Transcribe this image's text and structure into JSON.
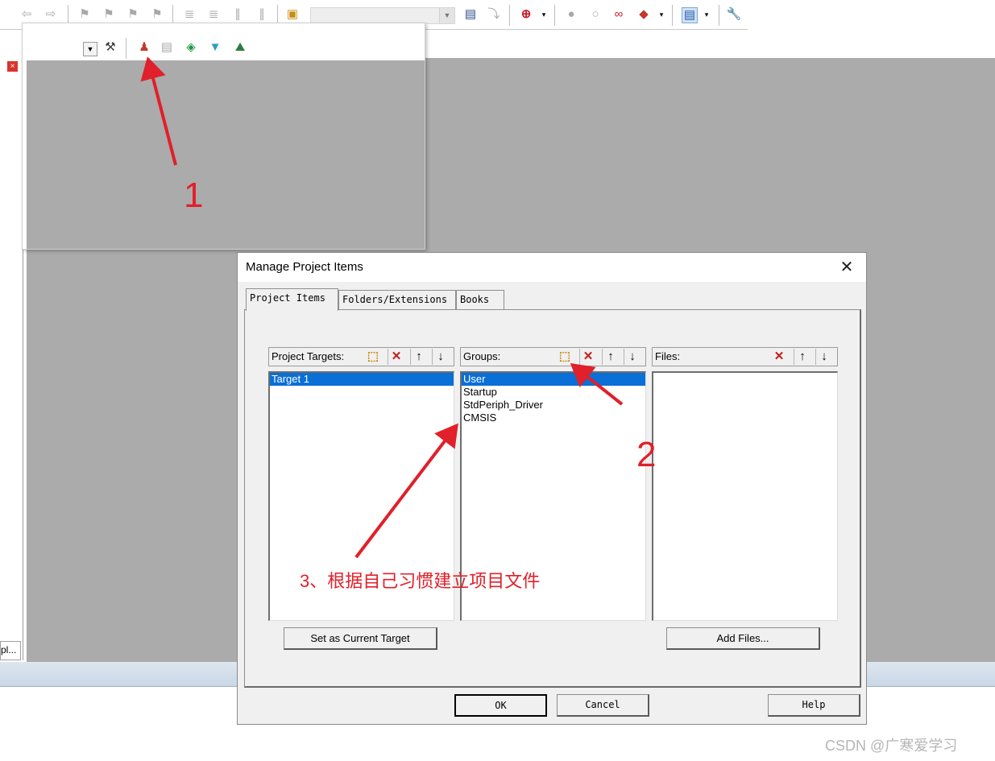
{
  "colors": {
    "annotation": "#e0202a",
    "selection": "#0a6fd6",
    "workspace": "#ababab"
  },
  "main_toolbar": {
    "icons": [
      "back-arrow-icon",
      "forward-arrow-icon",
      "bookmark-icon",
      "bookmark-prev-icon",
      "bookmark-next-icon",
      "bookmark-clear-icon",
      "indent-icon",
      "unindent-icon",
      "comment-icon",
      "uncomment-icon",
      "find-in-files-icon",
      "find-icon",
      "incremental-find-icon",
      "debug-start-icon",
      "breakpoint-icon",
      "breakpoint-disabled-icon",
      "breakpoint-kill-icon",
      "breakpoint-clear-icon",
      "window-layout-icon",
      "configure-icon"
    ]
  },
  "float_toolbar": {
    "icons": [
      "select-packs-icon",
      "manage-project-items-icon",
      "batch-build-icon",
      "build-target-icon",
      "rebuild-icon",
      "download-icon"
    ]
  },
  "left_panel": {
    "tab_label": "pl..."
  },
  "dialog": {
    "title": "Manage Project Items",
    "tabs": [
      {
        "label": "Project Items",
        "active": true
      },
      {
        "label": "Folders/Extensions",
        "active": false
      },
      {
        "label": "Books",
        "active": false
      }
    ],
    "targets": {
      "header": "Project Targets:",
      "items": [
        "Target 1"
      ],
      "selected": 0
    },
    "groups": {
      "header": "Groups:",
      "items": [
        "User",
        "Startup",
        "StdPeriph_Driver",
        "CMSIS"
      ],
      "selected": 0
    },
    "files": {
      "header": "Files:",
      "items": []
    },
    "buttons": {
      "set_current": "Set as Current Target",
      "add_files": "Add Files...",
      "ok": "OK",
      "cancel": "Cancel",
      "help": "Help"
    }
  },
  "annotations": {
    "label1": "1",
    "label2": "2",
    "label3": "3、根据自己习惯建立项目文件"
  },
  "watermark": "CSDN @广寒爱学习"
}
